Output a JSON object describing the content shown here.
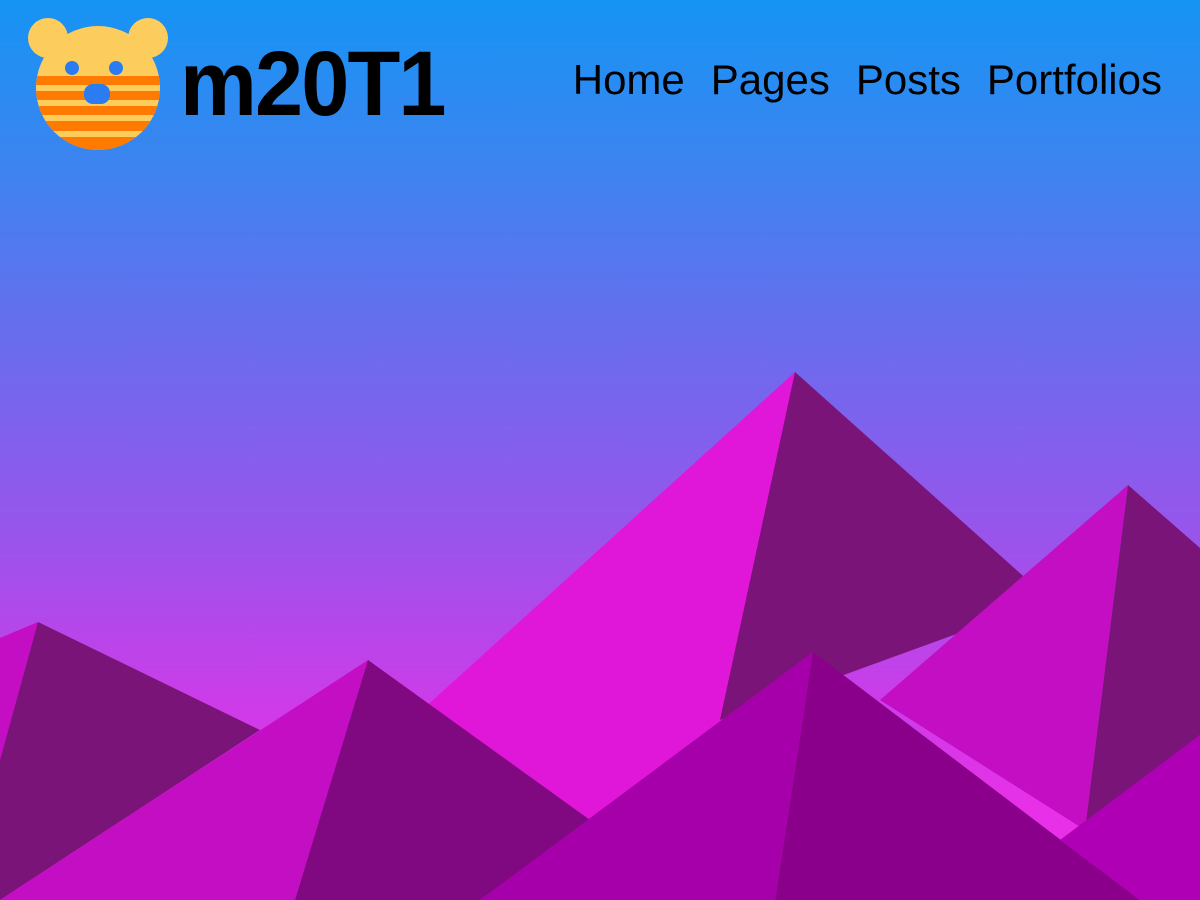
{
  "site": {
    "title": "m20T1",
    "logo_icon": "bear-face-icon"
  },
  "nav": {
    "items": [
      {
        "label": "Home"
      },
      {
        "label": "Pages"
      },
      {
        "label": "Posts"
      },
      {
        "label": "Portfolios"
      }
    ]
  },
  "colors": {
    "sky_top": "#1594f4",
    "sky_bottom": "#e830e8",
    "logo_yellow": "#fccd5c",
    "logo_orange": "#ff7a00",
    "mountain_light": "#e016d8",
    "mountain_mid": "#c40ec4",
    "mountain_dark": "#7a1478",
    "mountain_front": "#a400a8"
  }
}
